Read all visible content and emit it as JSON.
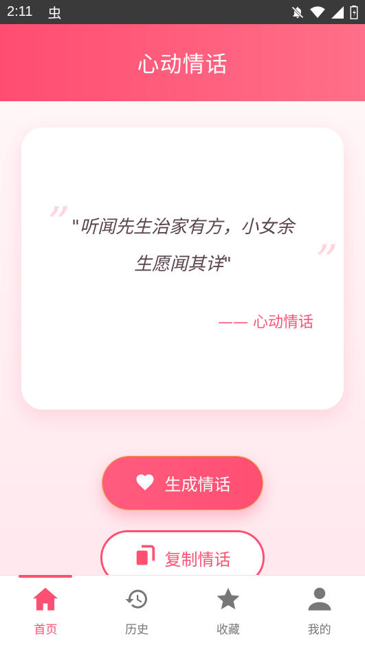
{
  "status_bar": {
    "time": "2:11",
    "app_indicator": "虫",
    "icons": [
      "notifications-off-icon",
      "wifi-icon",
      "cell-signal-icon",
      "battery-icon"
    ]
  },
  "header": {
    "title": "心动情话"
  },
  "quote_card": {
    "open_mark": "”",
    "close_mark": "”",
    "text": "\"听闻先生治家有方，小女余生愿闻其详\"",
    "attribution": "—— 心动情话"
  },
  "buttons": {
    "generate": {
      "label": "生成情话",
      "icon": "heart-icon"
    },
    "copy": {
      "label": "复制情话",
      "icon": "copy-icon"
    }
  },
  "tab_bar": {
    "items": [
      {
        "label": "首页",
        "icon": "home-icon",
        "active": true
      },
      {
        "label": "历史",
        "icon": "history-icon",
        "active": false
      },
      {
        "label": "收藏",
        "icon": "star-icon",
        "active": false
      },
      {
        "label": "我的",
        "icon": "person-icon",
        "active": false
      }
    ]
  },
  "colors": {
    "accent": "#ff4f72",
    "header_gradient_start": "#ff4d71",
    "header_gradient_end": "#ff6f88",
    "inactive_tab": "#777777",
    "quote_text": "#5a4450"
  }
}
